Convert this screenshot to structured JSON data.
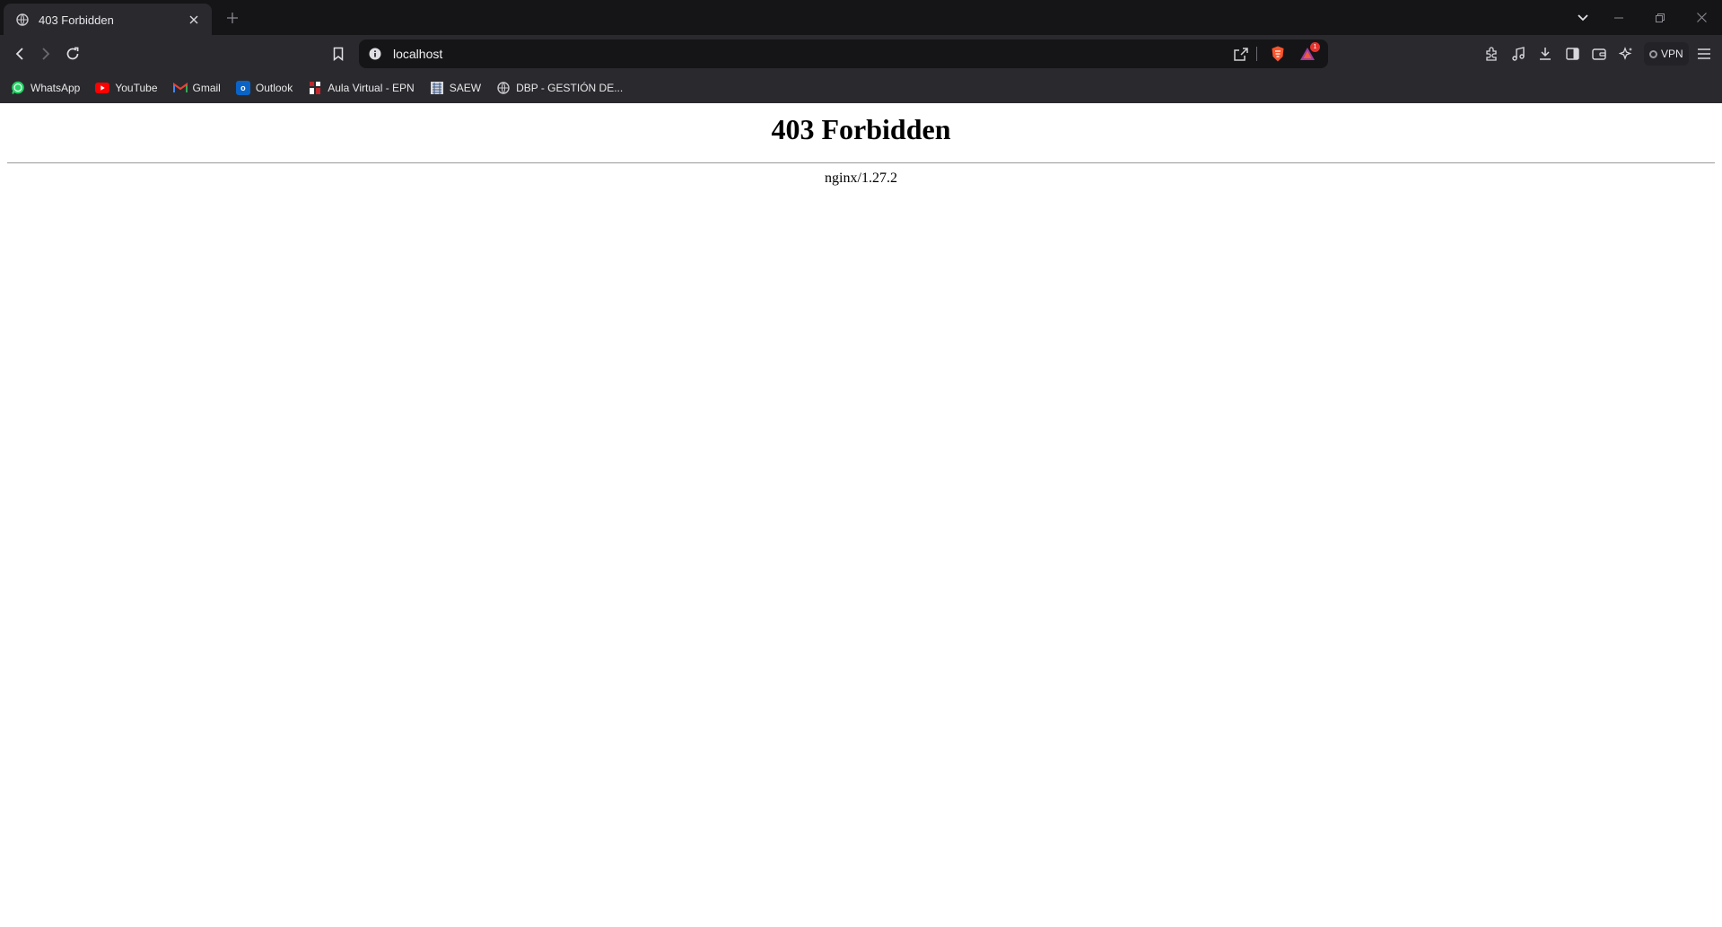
{
  "tab": {
    "title": "403 Forbidden",
    "favicon": "globe-icon"
  },
  "toolbar": {
    "url": "localhost"
  },
  "rewards": {
    "badge_count": "1"
  },
  "vpn": {
    "label": "VPN"
  },
  "bookmarks": [
    {
      "label": "WhatsApp",
      "icon": "whatsapp-icon",
      "color": "#25d366"
    },
    {
      "label": "YouTube",
      "icon": "youtube-icon",
      "color": "#ff0000"
    },
    {
      "label": "Gmail",
      "icon": "gmail-icon",
      "color": "#ea4335"
    },
    {
      "label": "Outlook",
      "icon": "outlook-icon",
      "color": "#0a64c8"
    },
    {
      "label": "Aula Virtual - EPN",
      "icon": "epn-icon",
      "color": "#c0282d"
    },
    {
      "label": "SAEW",
      "icon": "saew-icon",
      "color": "#d8d8dc"
    },
    {
      "label": "DBP - GESTIÓN DE...",
      "icon": "globe-icon",
      "color": "#d8d8dc"
    }
  ],
  "page": {
    "heading": "403 Forbidden",
    "server": "nginx/1.27.2"
  },
  "colors": {
    "chrome_dark": "#151518",
    "chrome": "#2a2a2e",
    "accent_brave": "#fb542b"
  }
}
